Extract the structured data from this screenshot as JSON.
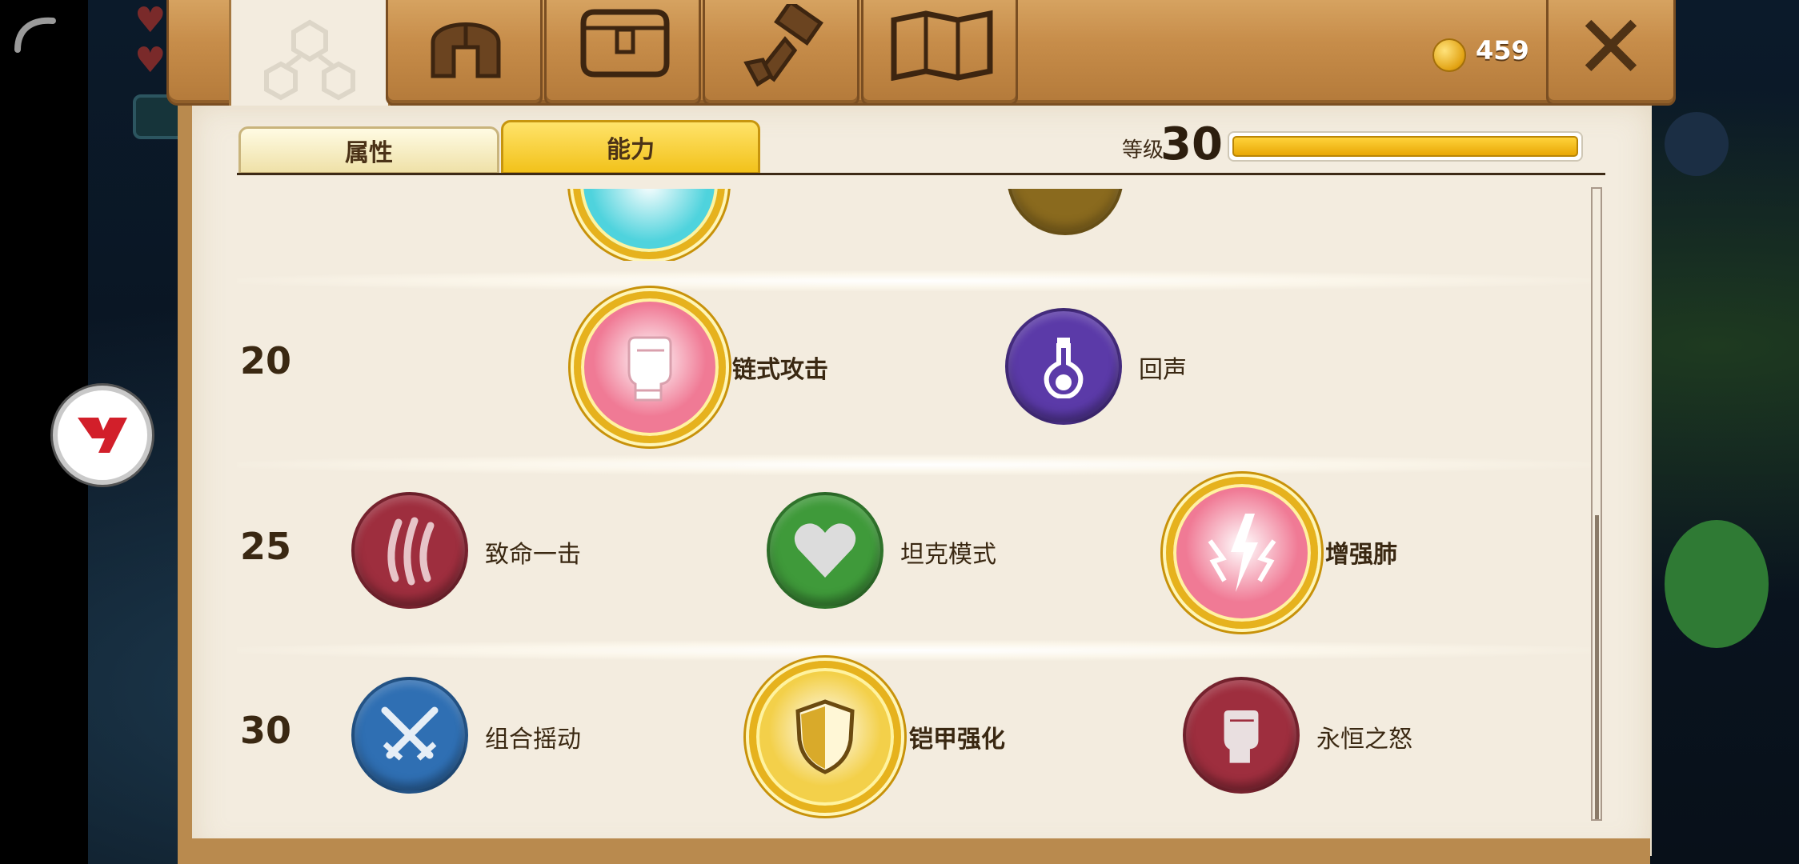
{
  "header": {
    "coins": "459",
    "close_icon": "close-icon",
    "tabs": [
      {
        "name": "skill-tree-tab",
        "icon": "skill-tree-icon"
      },
      {
        "name": "helmet-tab",
        "icon": "helmet-icon"
      },
      {
        "name": "inventory-tab",
        "icon": "bag-icon"
      },
      {
        "name": "crafting-tab",
        "icon": "hammer-icon"
      },
      {
        "name": "map-tab",
        "icon": "map-icon"
      }
    ]
  },
  "subtabs": {
    "attributes": "属性",
    "abilities": "能力"
  },
  "level": {
    "label": "等级",
    "value": "30",
    "progress": 1.0
  },
  "rows": [
    {
      "level": "20",
      "skills": [
        {
          "label": "链式攻击",
          "selected": true,
          "color": "#f07a95",
          "icon": "fist-icon"
        },
        {
          "label": "回声",
          "selected": false,
          "color": "#5b3aa8",
          "icon": "flask-icon"
        }
      ]
    },
    {
      "level": "25",
      "skills": [
        {
          "label": "致命一击",
          "selected": false,
          "color": "#9e2e3e",
          "icon": "claw-icon"
        },
        {
          "label": "坦克模式",
          "selected": false,
          "color": "#3f9a3a",
          "icon": "heart-icon"
        },
        {
          "label": "增强肺",
          "selected": true,
          "color": "#f07a95",
          "icon": "lightning-icon"
        }
      ]
    },
    {
      "level": "30",
      "skills": [
        {
          "label": "组合摇动",
          "selected": false,
          "color": "#2f6fb3",
          "icon": "swords-icon"
        },
        {
          "label": "铠甲强化",
          "selected": true,
          "color": "#f3d04a",
          "icon": "shield-icon"
        },
        {
          "label": "永恒之怒",
          "selected": false,
          "color": "#9e2e3e",
          "icon": "fist-icon"
        }
      ]
    }
  ],
  "partial_row": {
    "left_color": "#4fd3dd",
    "right_color": "#8a6a1e"
  }
}
